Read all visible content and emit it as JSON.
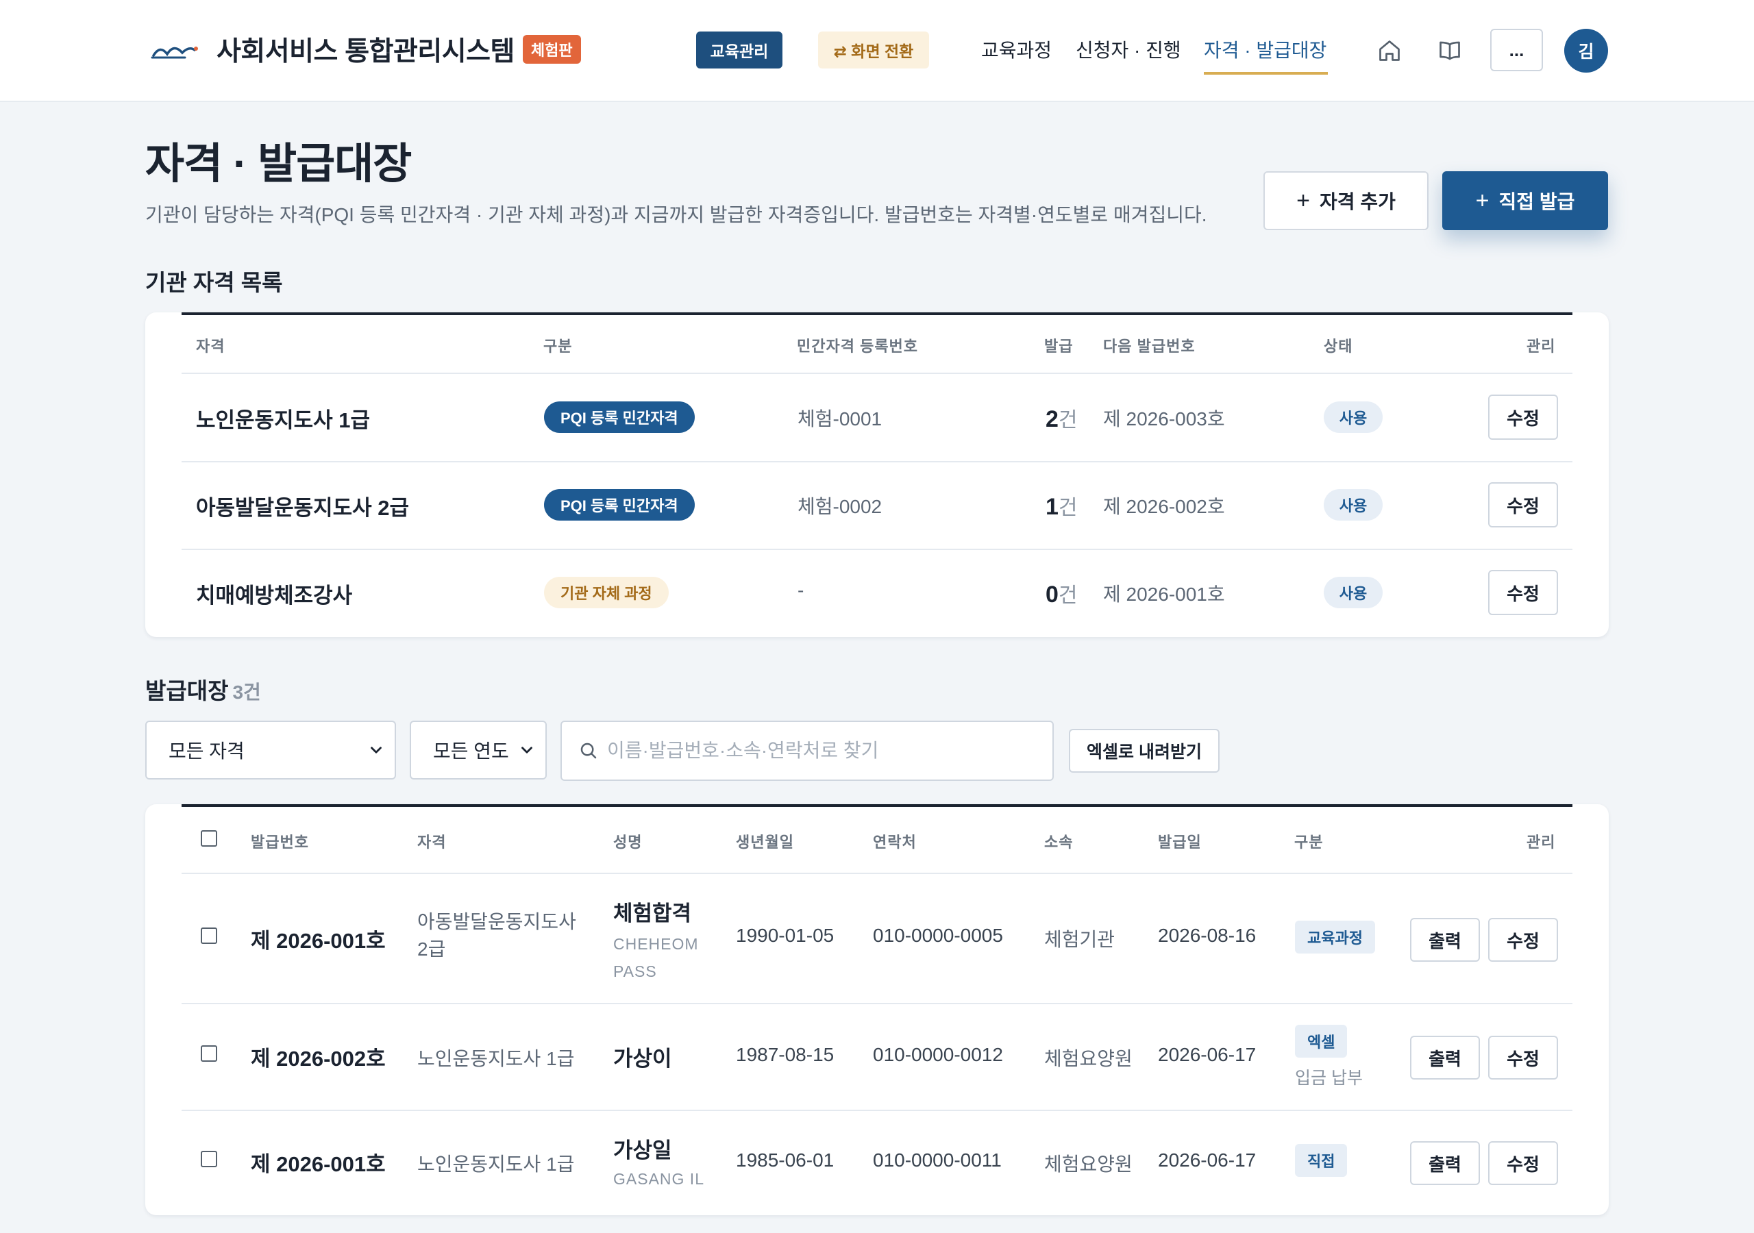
{
  "app": {
    "title": "사회서비스 통합관리시스템",
    "badge": "체험판"
  },
  "nav": {
    "edu_mgmt": "교육관리",
    "switch": "⇄ 화면 전환",
    "links": [
      "교육과정",
      "신청자 · 진행",
      "자격 · 발급대장"
    ],
    "active": "자격 · 발급대장",
    "more": "...",
    "avatar": "김"
  },
  "page": {
    "title": "자격 · 발급대장",
    "description": "기관이 담당하는 자격(PQI 등록 민간자격 · 기관 자체 과정)과 지금까지 발급한 자격증입니다. 발급번호는 자격별·연도별로 매겨집니다.",
    "add_qualification": "자격 추가",
    "direct_issue": "직접 발급"
  },
  "qualifications": {
    "section_title": "기관 자격 목록",
    "headers": [
      "자격",
      "구분",
      "민간자격 등록번호",
      "발급",
      "다음 발급번호",
      "상태",
      "관리"
    ],
    "rows": [
      {
        "name": "노인운동지도사 1급",
        "type": "PQI 등록 민간자격",
        "reg_no": "체험-0001",
        "issued": "2",
        "unit": "건",
        "next_no": "제 2026-003호",
        "status": "사용",
        "action": "수정"
      },
      {
        "name": "아동발달운동지도사 2급",
        "type": "PQI 등록 민간자격",
        "reg_no": "체험-0002",
        "issued": "1",
        "unit": "건",
        "next_no": "제 2026-002호",
        "status": "사용",
        "action": "수정"
      },
      {
        "name": "치매예방체조강사",
        "type": "기관 자체 과정",
        "reg_no": "-",
        "issued": "0",
        "unit": "건",
        "next_no": "제 2026-001호",
        "status": "사용",
        "action": "수정"
      }
    ]
  },
  "ledger": {
    "section_title": "발급대장",
    "count": "3건",
    "filter_qualification": "모든 자격",
    "filter_year": "모든 연도",
    "search_placeholder": "이름·발급번호·소속·연락처로 찾기",
    "excel_button": "엑셀로 내려받기",
    "headers": [
      "발급번호",
      "자격",
      "성명",
      "생년월일",
      "연락처",
      "소속",
      "발급일",
      "구분",
      "관리"
    ],
    "rows": [
      {
        "no": "제 2026-001호",
        "qualification": "아동발달운동지도사 2급",
        "name": "체험합격",
        "name_en": "CHEHEOM PASS",
        "birth": "1990-01-05",
        "phone": "010-0000-0005",
        "org": "체험기관",
        "date": "2026-08-16",
        "kind": "교육과정",
        "kind_note": "",
        "print": "출력",
        "edit": "수정"
      },
      {
        "no": "제 2026-002호",
        "qualification": "노인운동지도사 1급",
        "name": "가상이",
        "name_en": "",
        "birth": "1987-08-15",
        "phone": "010-0000-0012",
        "org": "체험요양원",
        "date": "2026-06-17",
        "kind": "엑셀",
        "kind_note": "입금 납부",
        "print": "출력",
        "edit": "수정"
      },
      {
        "no": "제 2026-001호",
        "qualification": "노인운동지도사 1급",
        "name": "가상일",
        "name_en": "GASANG IL",
        "birth": "1985-06-01",
        "phone": "010-0000-0011",
        "org": "체험요양원",
        "date": "2026-06-17",
        "kind": "직접",
        "kind_note": "",
        "print": "출력",
        "edit": "수정"
      }
    ]
  },
  "colors": {
    "primary": "#1e5a92",
    "brand_badge": "#e2653a",
    "accent_gold": "#d8ad52",
    "background": "#f2f5f8"
  }
}
